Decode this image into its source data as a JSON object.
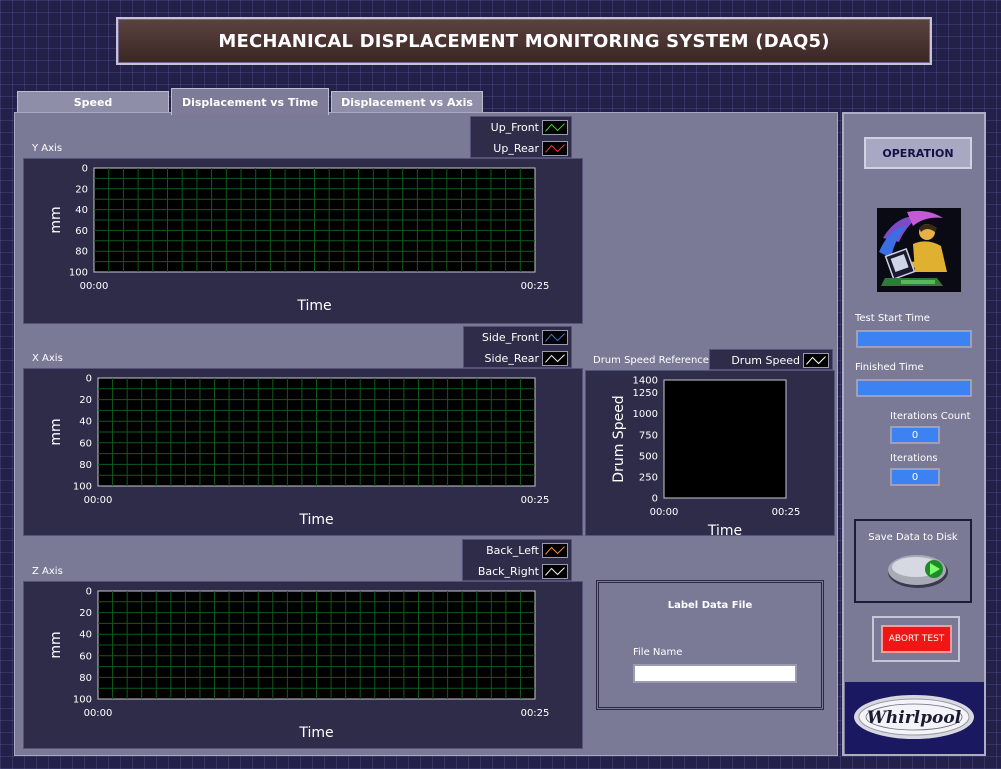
{
  "header": {
    "title": "MECHANICAL DISPLACEMENT MONITORING SYSTEM (DAQ5)"
  },
  "tabs": [
    {
      "label": "Speed"
    },
    {
      "label": "Displacement vs Time",
      "active": true
    },
    {
      "label": "Displacement vs Axis"
    }
  ],
  "charts": {
    "y_axis": {
      "label": "Y Axis",
      "ylabel": "mm",
      "xlabel": "Time",
      "legend": [
        {
          "name": "Up_Front",
          "color": "#3ccf3c"
        },
        {
          "name": "Up_Rear",
          "color": "#e83a3a"
        }
      ]
    },
    "x_axis": {
      "label": "X Axis",
      "ylabel": "mm",
      "xlabel": "Time",
      "legend": [
        {
          "name": "Side_Front",
          "color": "#4a6ed6"
        },
        {
          "name": "Side_Rear",
          "color": "#e8e8e8"
        }
      ]
    },
    "z_axis": {
      "label": "Z Axis",
      "ylabel": "mm",
      "xlabel": "Time",
      "legend": [
        {
          "name": "Back_Left",
          "color": "#ee8a3a"
        },
        {
          "name": "Back_Right",
          "color": "#f0f0f0"
        }
      ]
    },
    "drum": {
      "label": "Drum Speed Reference",
      "ylabel": "Drum Speed",
      "xlabel": "Time",
      "legend": [
        {
          "name": "Drum Speed",
          "color": "#ffffff"
        }
      ]
    }
  },
  "chart_data": [
    {
      "type": "line",
      "title": "Y Axis",
      "xlabel": "Time",
      "ylabel": "mm",
      "x_ticks": [
        "00:00",
        "00:25"
      ],
      "y_ticks": [
        0,
        20,
        40,
        60,
        80,
        100
      ],
      "ylim": [
        100,
        0
      ],
      "grid": true,
      "series": [
        {
          "name": "Up_Front",
          "values": []
        },
        {
          "name": "Up_Rear",
          "values": []
        }
      ]
    },
    {
      "type": "line",
      "title": "X Axis",
      "xlabel": "Time",
      "ylabel": "mm",
      "x_ticks": [
        "00:00",
        "00:25"
      ],
      "y_ticks": [
        0,
        20,
        40,
        60,
        80,
        100
      ],
      "ylim": [
        100,
        0
      ],
      "grid": true,
      "series": [
        {
          "name": "Side_Front",
          "values": []
        },
        {
          "name": "Side_Rear",
          "values": []
        }
      ]
    },
    {
      "type": "line",
      "title": "Z Axis",
      "xlabel": "Time",
      "ylabel": "mm",
      "x_ticks": [
        "00:00",
        "00:25"
      ],
      "y_ticks": [
        0,
        20,
        40,
        60,
        80,
        100
      ],
      "ylim": [
        100,
        0
      ],
      "grid": true,
      "series": [
        {
          "name": "Back_Left",
          "values": []
        },
        {
          "name": "Back_Right",
          "values": []
        }
      ]
    },
    {
      "type": "line",
      "title": "Drum Speed Reference",
      "xlabel": "Time",
      "ylabel": "Drum Speed",
      "x_ticks": [
        "00:00",
        "00:25"
      ],
      "y_ticks": [
        0,
        250,
        500,
        750,
        1000,
        1250,
        1400
      ],
      "ylim": [
        0,
        1400
      ],
      "grid": false,
      "series": [
        {
          "name": "Drum Speed",
          "values": []
        }
      ]
    }
  ],
  "controls": {
    "operation_label": "OPERATION",
    "test_start_label": "Test Start Time",
    "test_start_value": "",
    "finished_label": "Finished Time",
    "finished_value": "",
    "iterations_count_label": "Iterations Count",
    "iterations_count_value": "0",
    "iterations_label": "Iterations",
    "iterations_value": "0",
    "save_label": "Save Data to Disk",
    "abort_label": "ABORT TEST"
  },
  "label_file": {
    "title": "Label Data File",
    "file_name_label": "File Name",
    "file_name_value": ""
  },
  "brand": {
    "logo": "Whirlpool",
    "icon": "operator-at-computer-icon"
  }
}
